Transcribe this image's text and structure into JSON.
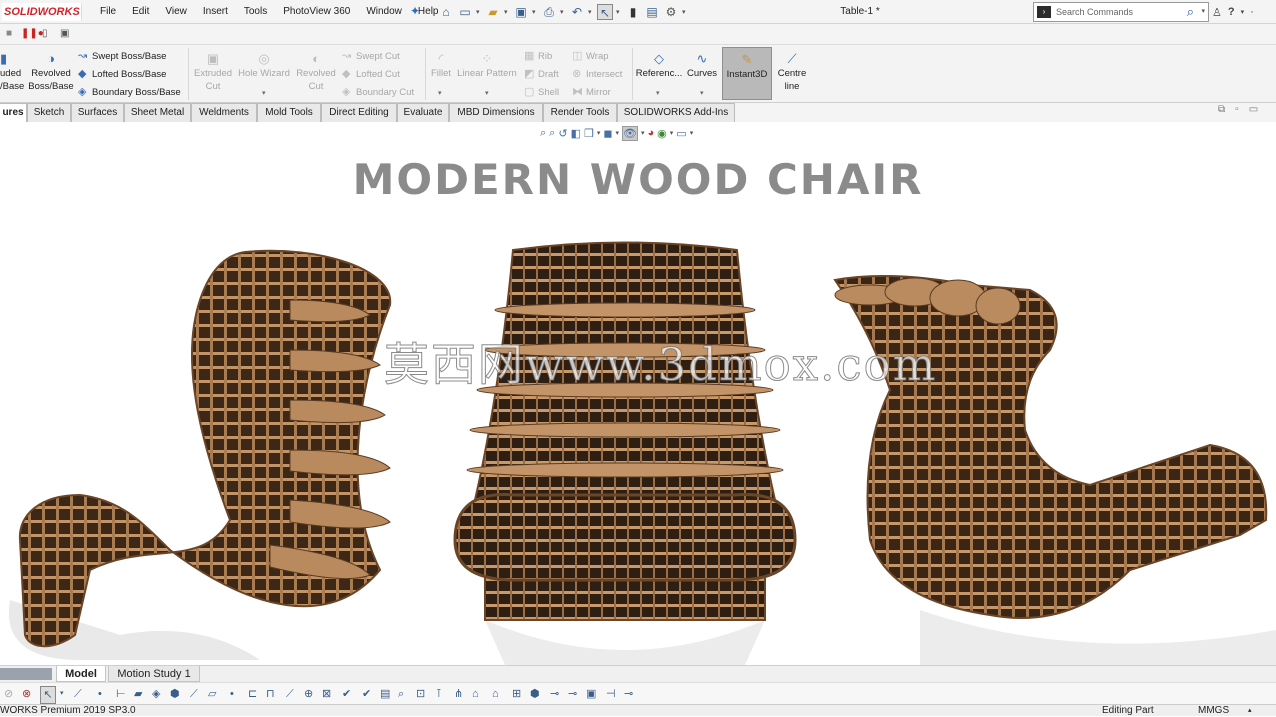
{
  "app": {
    "logo": "SOLIDWORKS",
    "doc_title": "Table-1 *"
  },
  "menu": [
    "File",
    "Edit",
    "View",
    "Insert",
    "Tools",
    "PhotoView 360",
    "Window",
    "Help"
  ],
  "search": {
    "placeholder": "Search Commands"
  },
  "cmd": {
    "extruded": "uded\n/Base",
    "revolved": "Revolved\nBoss/Base",
    "swept": "Swept Boss/Base",
    "lofted": "Lofted Boss/Base",
    "boundary": "Boundary Boss/Base",
    "extruded_cut": "Extruded\nCut",
    "hole_wizard": "Hole Wizard",
    "revolved_cut": "Revolved\nCut",
    "swept_cut": "Swept Cut",
    "lofted_cut": "Lofted Cut",
    "boundary_cut": "Boundary Cut",
    "fillet": "Fillet",
    "linear_pattern": "Linear Pattern",
    "rib": "Rib",
    "draft": "Draft",
    "shell": "Shell",
    "wrap": "Wrap",
    "intersect": "Intersect",
    "mirror": "Mirror",
    "reference": "Referenc...",
    "curves": "Curves",
    "instant3d": "Instant3D",
    "centre_line": "Centre\nline"
  },
  "tabs": [
    "ures",
    "Sketch",
    "Surfaces",
    "Sheet Metal",
    "Weldments",
    "Mold Tools",
    "Direct Editing",
    "Evaluate",
    "MBD Dimensions",
    "Render Tools",
    "SOLIDWORKS Add-Ins"
  ],
  "canvas": {
    "heading": "MODERN WOOD CHAIR",
    "watermark": "莫西网www.3dmox.com"
  },
  "bottom_tabs": {
    "model": "Model",
    "motion": "Motion Study 1"
  },
  "status": {
    "product": "WORKS Premium 2019 SP3.0",
    "mode": "Editing Part",
    "units": "MMGS"
  },
  "colors": {
    "wood": "#b88a5e",
    "wood_dark": "#5a3a22",
    "heading": "#8b8b8b",
    "brand": "#d2232a"
  }
}
